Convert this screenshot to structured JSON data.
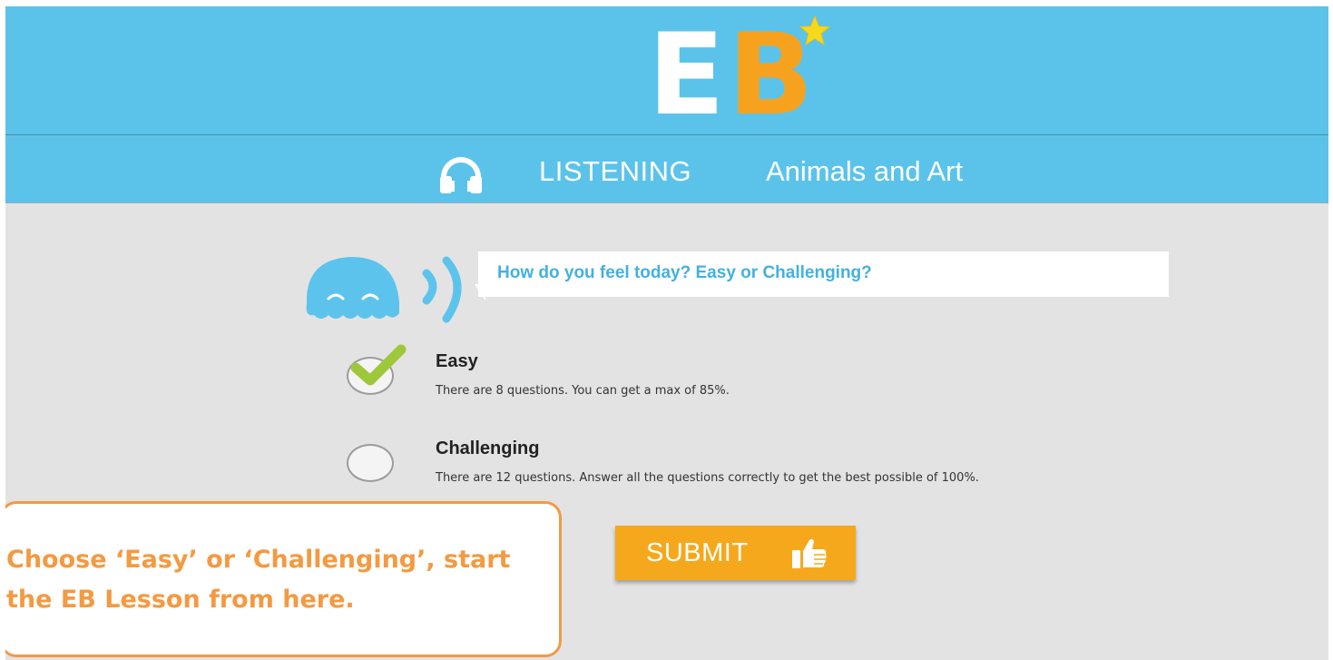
{
  "header": {
    "logo": {
      "letter1": "E",
      "letter2": "B"
    }
  },
  "lesson": {
    "type": "LISTENING",
    "name": "Animals and Art"
  },
  "prompt": {
    "question": "How do you feel today? Easy or Challenging?"
  },
  "options": [
    {
      "title": "Easy",
      "description": "There are 8 questions. You can get a max of 85%.",
      "selected": true
    },
    {
      "title": "Challenging",
      "description": "There are 12 questions. Answer all the questions correctly to get the best possible of 100%.",
      "selected": false
    }
  ],
  "submit": {
    "label": "SUBMIT"
  },
  "callout": {
    "text": "Choose ‘Easy’ or ‘Challenging’, start the EB Lesson from here."
  },
  "colors": {
    "header_blue": "#5bc3ea",
    "brand_orange": "#f6a21f",
    "callout_orange": "#f39a42",
    "check_green": "#9ec83b",
    "background_gray": "#e3e3e3"
  },
  "icons": {
    "lesson_type": "headphones-icon",
    "mascot": "mascot-speaking-icon",
    "selected_option": "checkmark-icon",
    "submit": "thumbs-up-icon"
  }
}
